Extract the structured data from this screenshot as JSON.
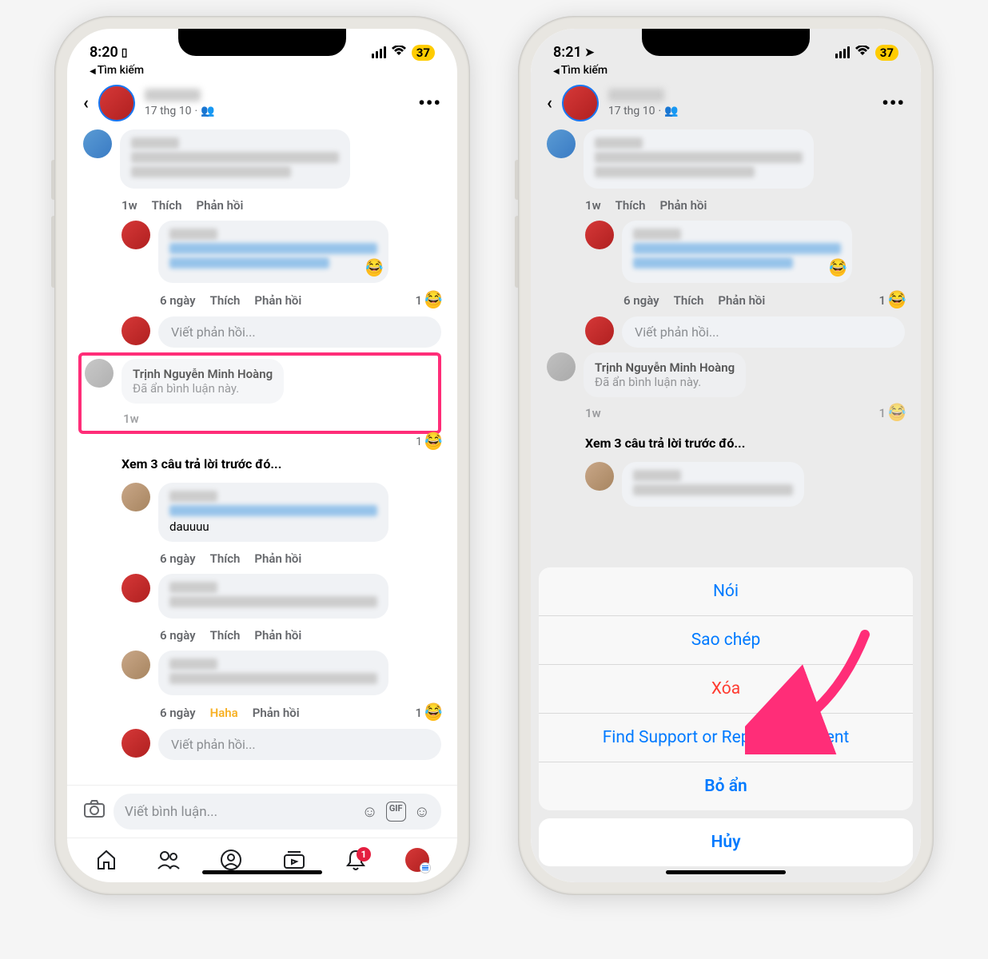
{
  "left": {
    "status": {
      "time": "8:20",
      "battery": "37",
      "back_search": "Tìm kiếm"
    },
    "post": {
      "date": "17 thg 10",
      "audience_icon": "friends"
    },
    "comment1": {
      "time": "1w",
      "like": "Thích",
      "reply": "Phản hồi"
    },
    "reply1": {
      "time": "6 ngày",
      "like": "Thích",
      "reply": "Phản hồi",
      "count": "1"
    },
    "reply_input": "Viết phản hồi...",
    "hidden": {
      "name": "Trịnh Nguyễn Minh Hoàng",
      "text": "Đã ẩn bình luận này.",
      "time": "1w",
      "count": "1"
    },
    "view_replies": "Xem 3 câu trả lời trước đó...",
    "reply2": {
      "body": "dauuuu",
      "time": "6 ngày",
      "like": "Thích",
      "reply": "Phản hồi"
    },
    "reply3": {
      "time": "6 ngày",
      "like": "Thích",
      "reply": "Phản hồi"
    },
    "reply4": {
      "time": "6 ngày",
      "haha": "Haha",
      "reply": "Phản hồi",
      "count": "1"
    },
    "comment_input": "Viết bình luận...",
    "notif_badge": "1"
  },
  "right": {
    "status": {
      "time": "8:21",
      "battery": "37",
      "back_search": "Tìm kiếm"
    },
    "post": {
      "date": "17 thg 10"
    },
    "comment1": {
      "time": "1w",
      "like": "Thích",
      "reply": "Phản hồi"
    },
    "reply1": {
      "time": "6 ngày",
      "like": "Thích",
      "reply": "Phản hồi",
      "count": "1"
    },
    "reply_input": "Viết phản hồi...",
    "hidden": {
      "name": "Trịnh Nguyễn Minh Hoàng",
      "text": "Đã ẩn bình luận này.",
      "time": "1w",
      "count": "1"
    },
    "view_replies": "Xem 3 câu trả lời trước đó...",
    "sheet": {
      "speak": "Nói",
      "copy": "Sao chép",
      "delete": "Xóa",
      "report": "Find Support or Report Comment",
      "unhide": "Bỏ ẩn",
      "cancel": "Hủy"
    }
  }
}
